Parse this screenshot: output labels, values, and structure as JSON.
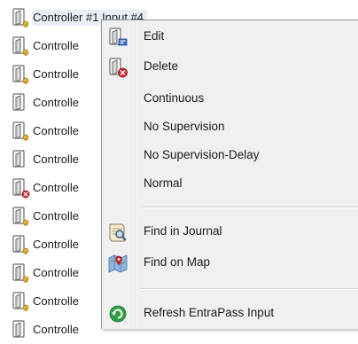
{
  "list": {
    "items": [
      {
        "label": "Controller #1 Input #4",
        "badge": "key",
        "selected": true
      },
      {
        "label": "Controlle",
        "badge": "key"
      },
      {
        "label": "Controlle",
        "badge": "key"
      },
      {
        "label": "Controlle",
        "badge": "none"
      },
      {
        "label": "Controlle",
        "badge": "key"
      },
      {
        "label": "Controlle",
        "badge": "none"
      },
      {
        "label": "Controlle",
        "badge": "stop"
      },
      {
        "label": "Controlle",
        "badge": "key"
      },
      {
        "label": "Controlle",
        "badge": "key"
      },
      {
        "label": "Controlle",
        "badge": "key"
      },
      {
        "label": "Controlle",
        "badge": "key"
      },
      {
        "label": "Controlle",
        "badge": "none"
      }
    ]
  },
  "menu": {
    "items": [
      {
        "label": "Edit",
        "icon": "edit-icon"
      },
      {
        "label": "Delete",
        "icon": "delete-icon"
      },
      {
        "label": "Continuous",
        "icon": ""
      },
      {
        "label": "No Supervision",
        "icon": ""
      },
      {
        "label": "No Supervision-Delay",
        "icon": ""
      },
      {
        "label": "Normal",
        "icon": ""
      },
      {
        "label": "Find in Journal",
        "icon": "journal-search-icon"
      },
      {
        "label": "Find on Map",
        "icon": "map-pin-icon"
      },
      {
        "label": "Refresh EntraPass Input",
        "icon": "refresh-icon"
      }
    ]
  },
  "colors": {
    "menu_bg": "#f0f0f0",
    "selection": "#e9eef6",
    "badge_key": "#e0b43c",
    "badge_stop": "#d4252a",
    "refresh_green": "#2ea043"
  }
}
